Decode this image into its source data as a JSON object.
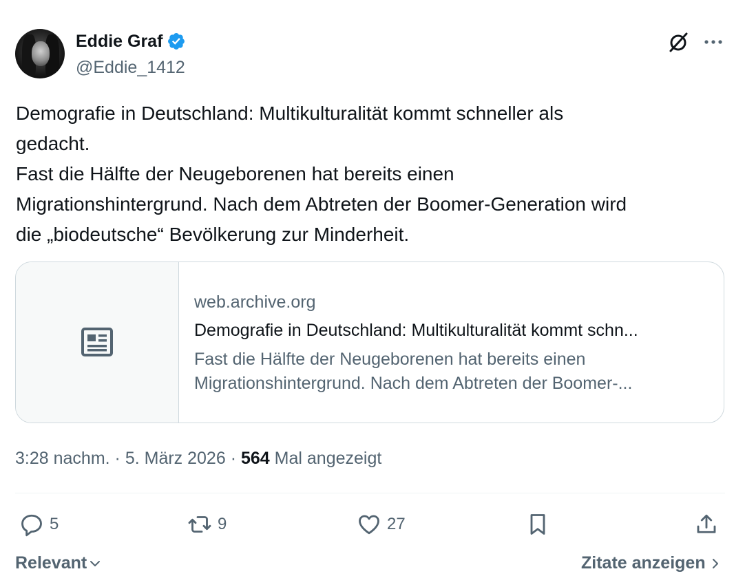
{
  "author": {
    "display_name": "Eddie Graf",
    "handle": "@Eddie_1412"
  },
  "tweet": {
    "lines": [
      "Demografie in Deutschland: Multikulturalität kommt schneller als",
      "gedacht.",
      "Fast die Hälfte der Neugeborenen hat bereits einen",
      "Migrationshintergrund. Nach dem Abtreten der Boomer-Generation wird",
      "die „biodeutsche“ Bevölkerung zur Minderheit."
    ]
  },
  "card": {
    "domain": "web.archive.org",
    "title": "Demografie in Deutschland: Multikulturalität kommt schn...",
    "description_lines": [
      "Fast die Hälfte der Neugeborenen hat bereits einen",
      "Migrationshintergrund. Nach dem Abtreten der Boomer-..."
    ]
  },
  "meta": {
    "time": "3:28 nachm.",
    "separator": "·",
    "date": "5. März 2026",
    "views_count": "564",
    "views_label": "Mal angezeigt"
  },
  "actions": {
    "replies": "5",
    "reposts": "9",
    "likes": "27"
  },
  "footer": {
    "sort_label": "Relevant",
    "quotes_label": "Zitate anzeigen"
  },
  "colors": {
    "verified": "#1d9bf0",
    "secondary_text": "#536471",
    "primary_text": "#0f1419",
    "border": "#cfd9de"
  },
  "icons": [
    "verified-badge-icon",
    "grok-icon",
    "more-icon",
    "article-icon",
    "reply-icon",
    "repost-icon",
    "like-icon",
    "bookmark-icon",
    "share-icon",
    "chevron-down-icon",
    "chevron-right-icon"
  ]
}
